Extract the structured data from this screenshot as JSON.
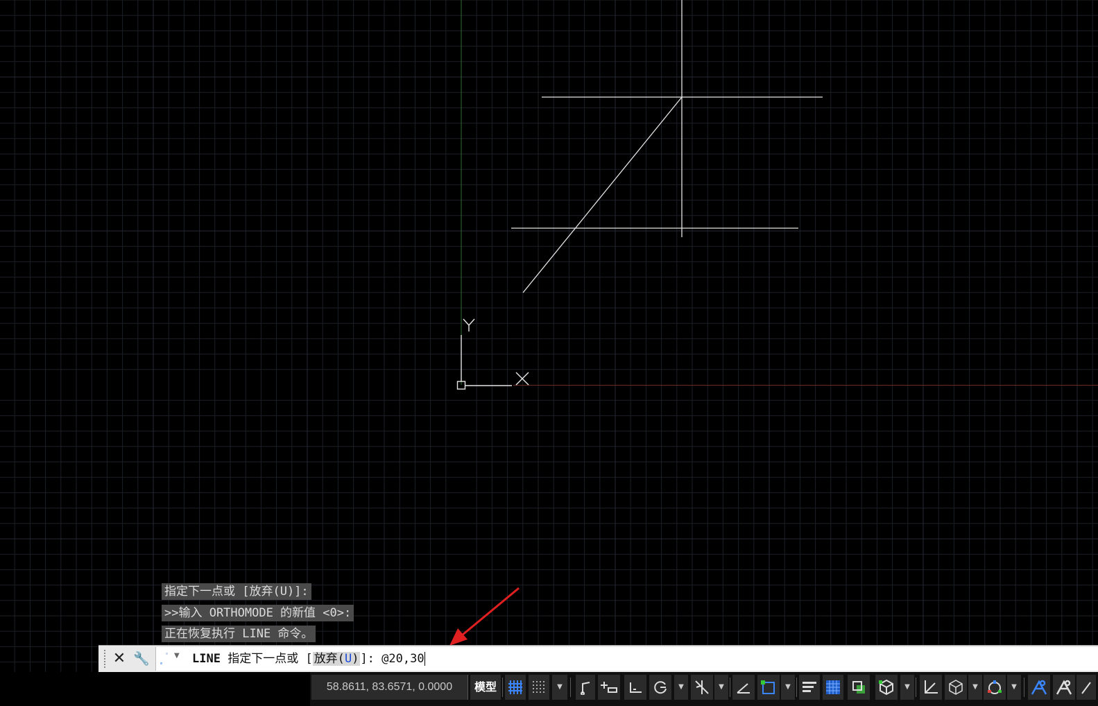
{
  "history": [
    "指定下一点或 [放弃(U)]:",
    ">>输入 ORTHOMODE 的新值 <0>:",
    "正在恢复执行 LINE 命令。"
  ],
  "command_line": {
    "command": "LINE",
    "prompt": "指定下一点或 [",
    "option_label": "放弃(",
    "option_key": "U",
    "option_close": ")",
    "prompt_end": "]: ",
    "input": "@20,30"
  },
  "ucs": {
    "y_label": "Y",
    "x_label": "X"
  },
  "status_bar": {
    "coordinates": "58.8611, 83.6571, 0.0000",
    "model_label": "模型"
  },
  "icons": {
    "close": "close-icon",
    "settings": "wrench-icon",
    "grid": "grid-icon",
    "snap": "snap-icon",
    "infer": "infer-constraints-icon",
    "dynamic_input": "dynamic-input-icon",
    "ortho": "ortho-icon",
    "polar": "polar-tracking-icon",
    "isodraft": "isodraft-icon",
    "object_snap_tracking": "object-snap-tracking-icon",
    "object_snap": "object-snap-icon",
    "lineweight": "lineweight-icon",
    "transparency": "transparency-icon",
    "selection_cycling": "selection-cycling-icon",
    "3d_osnap": "3d-osnap-icon",
    "dynamic_ucs": "dynamic-ucs-icon",
    "selection_filter": "selection-filter-icon",
    "gizmo": "gizmo-icon",
    "annotation_visibility": "annotation-visibility-icon",
    "auto_scale": "auto-scale-icon"
  },
  "colors": {
    "background": "#000000",
    "grid_minor": "#1c1f27",
    "grid_major": "#262a35",
    "y_axis": "#2f6b2f",
    "x_axis": "#6b2a22",
    "geometry": "#e6e6e6",
    "annotation_arrow": "#e02020",
    "accent_blue": "#3b86ff"
  }
}
